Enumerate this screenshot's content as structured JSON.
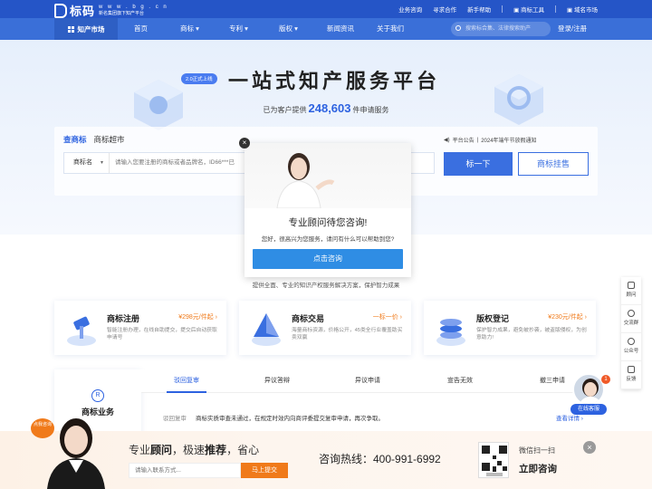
{
  "brand": {
    "name": "标码",
    "domain": "w w w . b g . c n",
    "tagline": "新名集团旗下知产平台"
  },
  "toplinks": [
    "业务咨询",
    "寻求合作",
    "新手帮助",
    "商标工具",
    "域名市场"
  ],
  "nav": {
    "market": "知产市场",
    "items": [
      "首页",
      "商标",
      "专利",
      "版权",
      "新闻资讯",
      "关于我们"
    ],
    "search_placeholder": "搜索标合集、法律搜索助产",
    "login": "登录/注册"
  },
  "hero": {
    "version_badge": "2.0正式上线",
    "title": "一站式知产服务平台",
    "subtitle_prefix": "已为客户提供",
    "count": "248,603",
    "subtitle_suffix": "件申请服务"
  },
  "search": {
    "tabs": [
      "查商标",
      "商标超市"
    ],
    "notice_label": "平台公告",
    "notice_text": "2024年端午节放假通知",
    "category": "商标名",
    "placeholder": "请输入您要注册的商标或者品牌名，ID66***已",
    "search_btn": "标一下",
    "list_btn": "商标挂售"
  },
  "popup": {
    "title": "专业顾问待您咨询!",
    "text": "您好，很高兴为您服务，请问有什么可以帮助到您?",
    "button": "点击咨询",
    "close": "×"
  },
  "provide_text": "提供全面、专业的知识产权服务解决方案，保护智力成果",
  "cards": [
    {
      "title": "商标注册",
      "price": "¥298元/件起 ›",
      "desc": "智能注册办理，在线自助提交，提交后自动获取申请号"
    },
    {
      "title": "商标交易",
      "price": "一标一价 ›",
      "desc": "海量商标资源，价格公开，45类全行业覆盖助买卖双赢"
    },
    {
      "title": "版权登记",
      "price": "¥230元/件起 ›",
      "desc": "保护智力成果，避免被抄袭，被盗版侵权，为创意助力!"
    }
  ],
  "business": {
    "title": "商标业务",
    "tabs": [
      "驳回复审",
      "异议答辩",
      "异议申请",
      "宣告无效",
      "撤三申请"
    ],
    "row_key": "驳回复审",
    "row_text": "商标实质审查未通过，在规定时效内向商评委提交复审申请，再次争取。",
    "more": "查看详情 ›"
  },
  "side": [
    "顾问",
    "交流群",
    "公众号",
    "反馈"
  ],
  "online": {
    "label": "在线客服",
    "badge": "1"
  },
  "bottom": {
    "tag": "点我咨询",
    "slogan_1": "专业",
    "slogan_2": "顾问",
    "slogan_3": "，极速",
    "slogan_4": "推荐",
    "slogan_5": "，省心",
    "input_placeholder": "请输入联系方式...",
    "submit": "马上提交",
    "hotline": "咨询热线：400-991-6992",
    "scan": "微信扫一扫",
    "now": "立即咨询",
    "close": "×"
  },
  "colors": {
    "primary": "#2d62e0",
    "topbar": "#2555c7",
    "nav": "#3a6fd8",
    "accent": "#f07a1a"
  }
}
